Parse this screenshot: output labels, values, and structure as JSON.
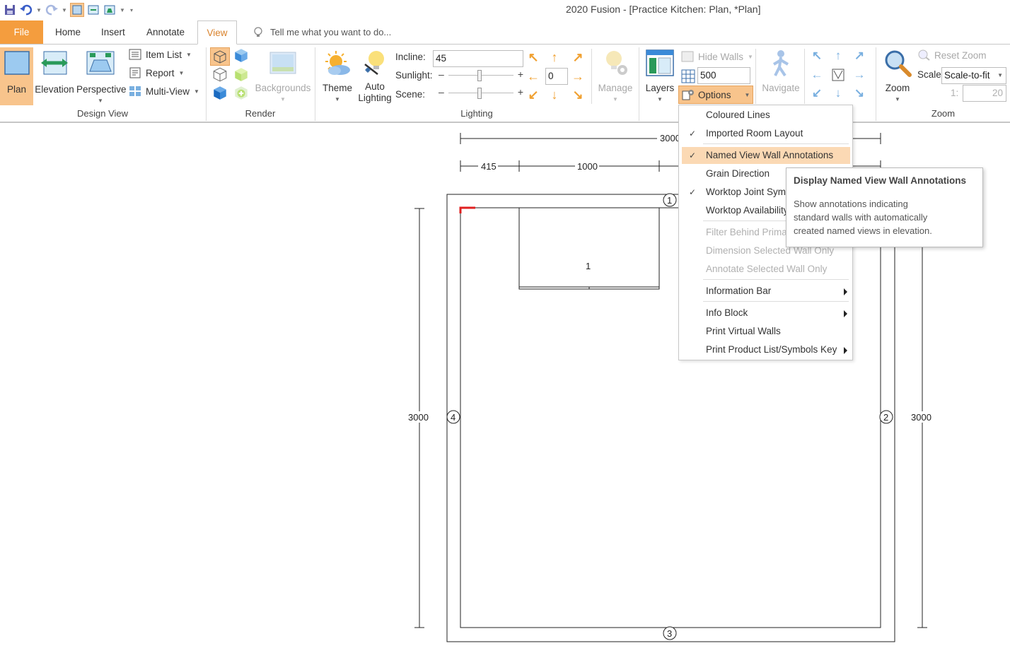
{
  "window": {
    "title": "2020 Fusion - [Practice Kitchen: Plan, *Plan]"
  },
  "tabs": {
    "file": "File",
    "home": "Home",
    "insert": "Insert",
    "annotate": "Annotate",
    "view": "View"
  },
  "tell_me": {
    "placeholder": "Tell me what you want to do..."
  },
  "design_view": {
    "label": "Design View",
    "plan": "Plan",
    "elevation": "Elevation",
    "perspective": "Perspective",
    "item_list": "Item List",
    "report": "Report",
    "multi_view": "Multi-View"
  },
  "render": {
    "label": "Render",
    "backgrounds": "Backgrounds"
  },
  "lighting": {
    "label": "Lighting",
    "theme": "Theme",
    "auto_lighting_1": "Auto",
    "auto_lighting_2": "Lighting",
    "incline_label": "Incline:",
    "incline_value": "45",
    "sunlight_label": "Sunlight:",
    "scene_label": "Scene:",
    "minus": "–",
    "plus": "+",
    "rotation_value": "0",
    "manage": "Manage"
  },
  "layers": {
    "layers": "Layers",
    "hide_walls": "Hide Walls",
    "wall_height_value": "500",
    "options": "Options",
    "navigate": "Navigate"
  },
  "zoom": {
    "label": "Zoom",
    "zoom": "Zoom",
    "reset_zoom": "Reset Zoom",
    "scale_label": "Scale:",
    "scale_value": "Scale-to-fit",
    "ratio_label": "1:",
    "ratio_value": "20"
  },
  "options_menu": {
    "items": [
      {
        "label": "Coloured Lines"
      },
      {
        "label": "Imported Room Layout"
      },
      {
        "label": "Named View Wall Annotations"
      },
      {
        "label": "Grain Direction"
      },
      {
        "label": "Worktop Joint Symbols"
      },
      {
        "label": "Worktop Availability"
      },
      {
        "label": "Filter Behind Primary"
      },
      {
        "label": "Dimension Selected Wall Only"
      },
      {
        "label": "Annotate Selected Wall Only"
      },
      {
        "label": "Information Bar"
      },
      {
        "label": "Info Block"
      },
      {
        "label": "Print Virtual Walls"
      },
      {
        "label": "Print Product List/Symbols Key"
      }
    ],
    "check": "✓"
  },
  "tooltip": {
    "title": "Display Named View Wall Annotations",
    "line1": "Show annotations indicating",
    "line2": "standard walls with automatically",
    "line3": "created named views in elevation."
  },
  "plan": {
    "dim_top_overall": "3000",
    "dim_segment_1": "415",
    "dim_segment_2": "1000",
    "dim_left": "3000",
    "dim_right": "3000",
    "wall_1": "1",
    "wall_2": "2",
    "wall_3": "3",
    "wall_4": "4",
    "cabinet_label": "1"
  },
  "colors": {
    "accent": "#f49d3e",
    "active_tab_text": "#d9822b",
    "menu_highlight": "#fbd9b4",
    "corner_marker": "#e02020"
  }
}
